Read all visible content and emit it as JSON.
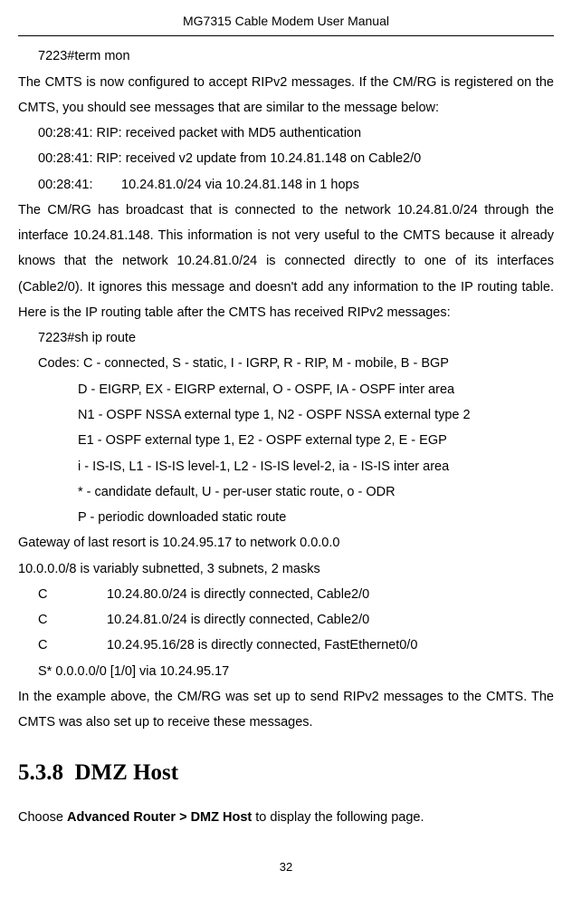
{
  "header": {
    "title": "MG7315 Cable Modem User Manual"
  },
  "body": {
    "term_cmd": "7223#term mon",
    "cmts_intro": "The CMTS is now configured to accept RIPv2 messages. If the CM/RG is registered on the CMTS, you should see messages that are similar to the message below:",
    "log1": "00:28:41: RIP: received packet with MD5 authentication",
    "log2": "00:28:41: RIP: received v2 update from 10.24.81.148 on Cable2/0",
    "log3_a": "00:28:41:",
    "log3_b": "10.24.81.0/24 via 10.24.81.148 in 1 hops",
    "broadcast": "The CM/RG   has broadcast that is connected to the network 10.24.81.0/24 through the interface 10.24.81.148. This information is not very useful to the CMTS because it already knows that the network 10.24.81.0/24 is connected directly to one of its interfaces (Cable2/0). It ignores this message and doesn't add any information to the IP routing table. Here is the IP routing table after the CMTS has received RIPv2 messages:",
    "sh_cmd": "7223#sh ip route",
    "codes_header": "Codes: C - connected, S - static, I - IGRP, R - RIP, M - mobile, B - BGP",
    "codes": [
      "D - EIGRP, EX - EIGRP external, O - OSPF, IA - OSPF inter area",
      "N1 - OSPF NSSA external type 1, N2 - OSPF NSSA external type 2",
      "E1 - OSPF external type 1, E2 - OSPF external type 2, E - EGP",
      "i - IS-IS, L1 - IS-IS level-1, L2 - IS-IS level-2, ia - IS-IS inter area",
      "* - candidate default, U - per-user static route, o - ODR",
      "P - periodic downloaded static route"
    ],
    "gateway": "Gateway of last resort is 10.24.95.17 to network 0.0.0.0",
    "subnet": "10.0.0.0/8 is variably subnetted, 3 subnets, 2 masks",
    "routes": [
      {
        "code": "C",
        "rest": "10.24.80.0/24 is directly connected, Cable2/0"
      },
      {
        "code": "C",
        "rest": "10.24.81.0/24 is directly connected, Cable2/0"
      },
      {
        "code": "C",
        "rest": "10.24.95.16/28 is directly connected, FastEthernet0/0"
      }
    ],
    "sroute": "S*     0.0.0.0/0 [1/0] via 10.24.95.17",
    "example_text": "In the example above, the CM/RG was set up to send RIPv2 messages to the CMTS. The CMTS was also set up to receive these messages.",
    "section_num": "5.3.8",
    "section_title": "DMZ Host",
    "choose_prefix": "Choose ",
    "choose_bold": "Advanced Router > DMZ Host",
    "choose_suffix": " to display the following page."
  },
  "footer": {
    "page": "32"
  }
}
